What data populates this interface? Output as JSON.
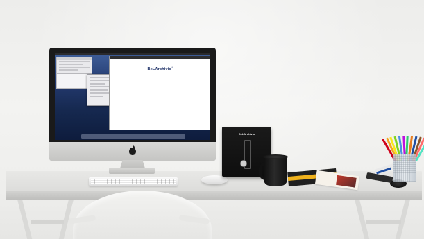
{
  "scene": {
    "imac": {
      "menubar": {
        "left": "",
        "right": ""
      },
      "browser": {
        "brand": "BxLArchivio",
        "brand_sup": "®",
        "nav": [
          "",
          "",
          ""
        ],
        "footer": ""
      },
      "dock_colors": [
        "#4a90e2",
        "#8e8e93",
        "#f5a623",
        "#7ed321",
        "#d0021b",
        "#50e3c2",
        "#bd10e0",
        "#9b9b9b",
        "#4a4a4a",
        "#f8e71c",
        "#417505",
        "#b8e986",
        "#ff6b6b",
        "#4a90e2",
        "#7b61ff",
        "#ffb300",
        "#2ecc71",
        "#e67e22",
        "#3498db",
        "#9b59b6",
        "#1abc9c",
        "#e74c3c",
        "#95a5a6",
        "#34495e",
        "#f1c40f",
        "#16a085",
        "#c0392b",
        "#2980b9",
        "#8e44ad",
        "#27ae60"
      ]
    },
    "device": {
      "brand": "BxLArchivio"
    },
    "pencil_colors": [
      "#d0021b",
      "#f5a623",
      "#f8e71c",
      "#7ed321",
      "#4a90e2",
      "#bd10e0",
      "#2ecc71",
      "#e67e22",
      "#1f4ea0",
      "#8b572a",
      "#ff6b6b",
      "#50e3c2"
    ]
  }
}
